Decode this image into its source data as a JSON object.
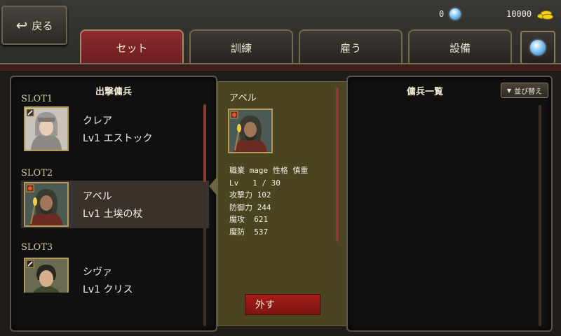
{
  "header": {
    "back_label": "戻る",
    "gems": "0",
    "gold": "10000",
    "tabs": [
      "セット",
      "訓練",
      "雇う",
      "設備"
    ],
    "active_tab": 0
  },
  "left_panel": {
    "title": "出撃傭兵",
    "slots": [
      {
        "label": "SLOT1",
        "name": "クレア",
        "info": "Lv1 エストック",
        "weapon_icon": "sword-icon"
      },
      {
        "label": "SLOT2",
        "name": "アベル",
        "info": "Lv1 土埃の杖",
        "weapon_icon": "staff-icon",
        "selected": true
      },
      {
        "label": "SLOT3",
        "name": "シヴァ",
        "info": "Lv1 クリス",
        "weapon_icon": "dagger-icon"
      }
    ]
  },
  "detail": {
    "name": "アベル",
    "job_line": "職業 mage 性格 慎重",
    "level_line": "Lv   1 / 30",
    "attack_line": "攻撃力 102",
    "defense_line": "防御力 244",
    "magic_attack_line": "魔攻  621",
    "magic_defense_line": "魔防  537",
    "remove_label": "外す"
  },
  "right_panel": {
    "title": "傭兵一覧",
    "sort_label": "並び替え"
  },
  "colors": {
    "active_tab": "#8e2a2e",
    "detail_bg": "#4a4420",
    "remove_button": "#a51c18",
    "portrait_frame": "#b59a5a"
  }
}
